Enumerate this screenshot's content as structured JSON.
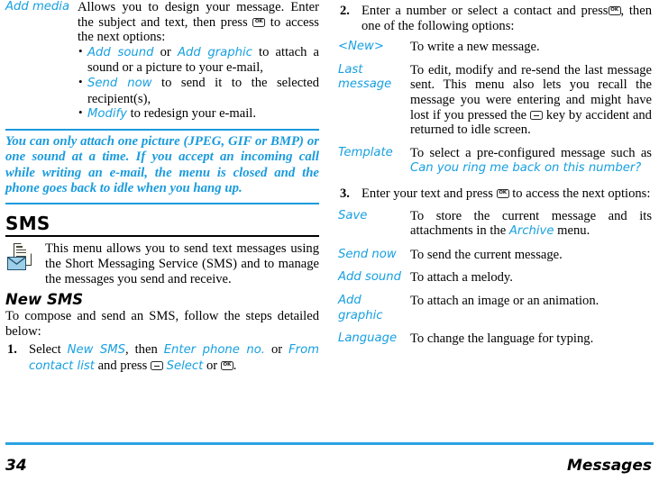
{
  "accent_color": "#17a0e0",
  "note_color": "#1a9bdd",
  "left_column": {
    "add_media_row": {
      "label": "Add media",
      "intro_1": "Allows you to design your message. Enter the subject and text, then press",
      "intro_2": "to access the next options:",
      "bullets": [
        {
          "pre": "",
          "link1": "Add sound",
          "mid": "or",
          "link2": "Add graphic",
          "post": "to attach a sound or a picture to your e-mail,"
        },
        {
          "pre": "",
          "link1": "Send now",
          "mid": "",
          "link2": "",
          "post": "to send it to the selected recipient(s),"
        },
        {
          "pre": "",
          "link1": "Modify",
          "mid": "",
          "link2": "",
          "post": "to redesign your e-mail."
        }
      ]
    },
    "note": "You can only attach one picture (JPEG, GIF or BMP) or one sound at a time. If you accept an incoming call while writing an e-mail, the menu is closed and the phone goes back to idle when you hang up.",
    "sms_heading": "SMS",
    "sms_intro": "This menu allows you to send text messages using the Short Messaging Service (SMS) and to manage the messages you send and receive.",
    "new_sms_heading": "New SMS",
    "new_sms_intro": "To compose and send an SMS, follow the steps detailed below:",
    "step1": {
      "number": "1.",
      "t1": "Select",
      "l1": "New SMS",
      "t2": ", then",
      "l2": "Enter phone no.",
      "t3": "or",
      "l3": "From contact list",
      "t4": "and press",
      "l4": "Select",
      "t5": "or",
      "t6": "."
    }
  },
  "right_column": {
    "step2": {
      "number": "2.",
      "t1": "Enter a number or select a contact and press",
      "t2": ", then one of the following options:"
    },
    "options_2": [
      {
        "label": "<New>",
        "desc": "To write a new message.",
        "desc2": "",
        "desc2_pre": "",
        "desc2_link": "",
        "desc2_post": ""
      },
      {
        "label": "Last message",
        "desc": "To edit, modify and re-send the last message sent.",
        "desc_extra_pre": "This menu also lets you recall the message you were entering and might have lost if you pressed the",
        "desc_extra_post": "key by accident and returned to idle screen."
      },
      {
        "label": "Template",
        "desc_pre": "To select a pre-configured message such as",
        "desc_link": "Can you ring me back on this number?"
      }
    ],
    "step3": {
      "number": "3.",
      "t1": "Enter your text and press",
      "t2": "to access the next options:"
    },
    "options_3": [
      {
        "label": "Save",
        "pre": "To store the current message and its attachments in the",
        "link": "Archive",
        "post": "menu."
      },
      {
        "label": "Send now",
        "pre": "To send the current message.",
        "link": "",
        "post": ""
      },
      {
        "label": "Add sound",
        "pre": "To attach a melody.",
        "link": "",
        "post": ""
      },
      {
        "label": "Add graphic",
        "pre": "To attach an image or an animation.",
        "link": "",
        "post": ""
      },
      {
        "label": "Language",
        "pre": "To change the language for typing.",
        "link": "",
        "post": ""
      }
    ]
  },
  "footer": {
    "page_number": "34",
    "section": "Messages"
  }
}
